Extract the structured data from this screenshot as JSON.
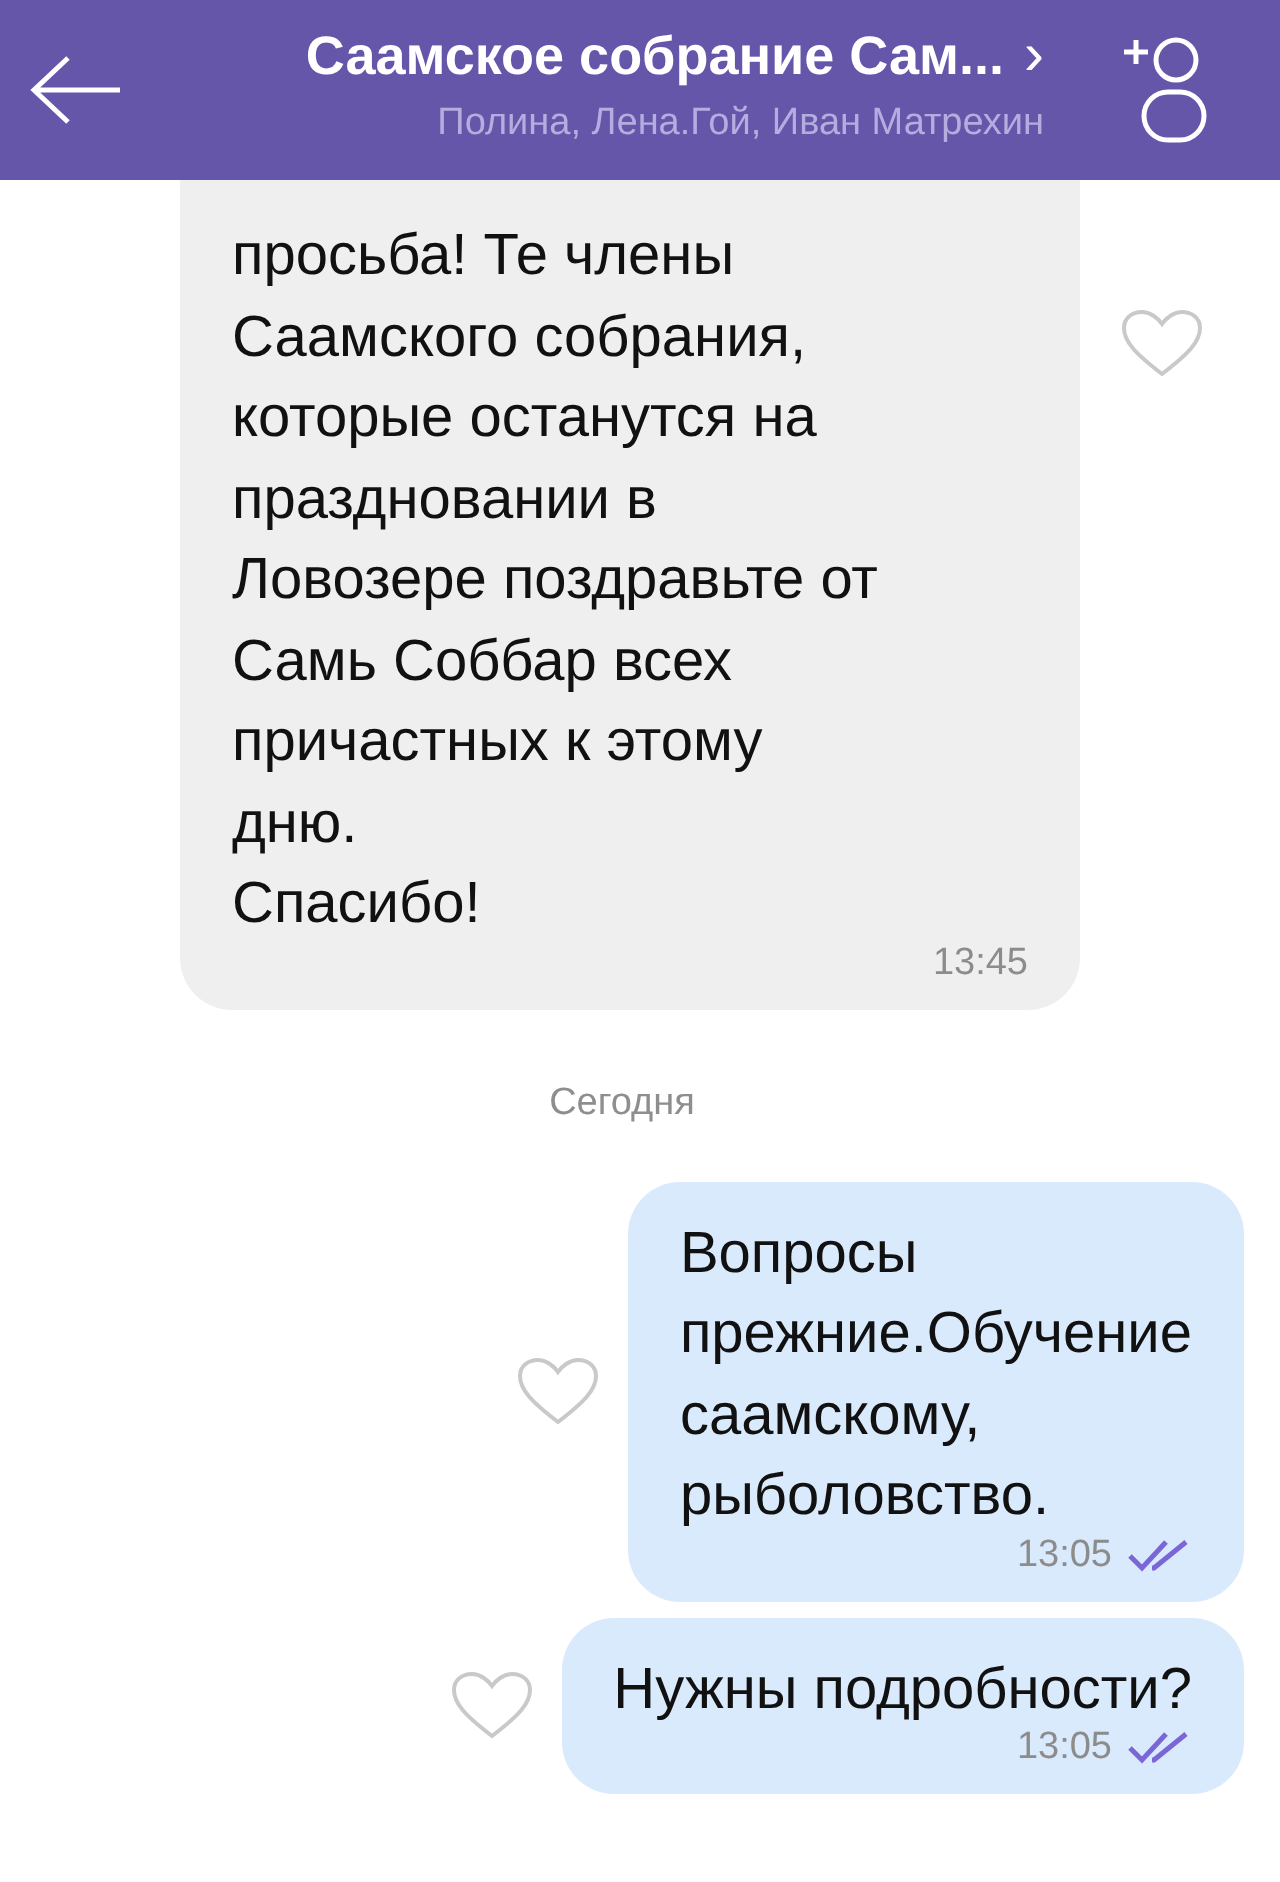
{
  "header": {
    "title": "Саамское собрание Сам...",
    "chevron": "›",
    "subtitle": "Полина, Лена.Гой, Иван Матрехин"
  },
  "messages": [
    {
      "kind": "incoming",
      "text": "просьба! Те члены\nСаамского собрания,\nкоторые останутся на\nпраздновании в\nЛовозере поздравьте от\nСамь Соббар всех\nпричастных к этому\nдню.\nСпасибо!",
      "time": "13:45",
      "liked": false
    },
    {
      "kind": "date",
      "text": "Сегодня"
    },
    {
      "kind": "outgoing",
      "text": "Вопросы\nпрежние.Обучение\nсаамскому,\nрыболовство.",
      "time": "13:05",
      "liked": false,
      "read": true
    },
    {
      "kind": "outgoing",
      "text": "Нужны подробности?",
      "time": "13:05",
      "liked": false,
      "read": true
    }
  ]
}
